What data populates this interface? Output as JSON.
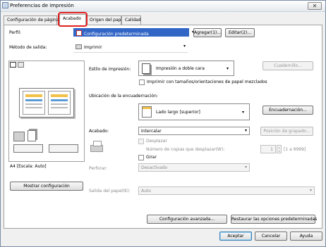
{
  "window": {
    "title": "Preferencias de impresión",
    "close_label": "✕"
  },
  "tabs": [
    {
      "label": "Configuración de página"
    },
    {
      "label": "Acabado"
    },
    {
      "label": "Origen del papel"
    },
    {
      "label": "Calidad"
    }
  ],
  "profile": {
    "label": "Perfil:",
    "value": "Configuración predeterminada",
    "add_button": "Agregar(1)...",
    "edit_button": "Editar(2)..."
  },
  "output_method": {
    "label": "Método de salida:",
    "value": "Imprimir"
  },
  "print_style": {
    "label": "Estilo de impresión:",
    "value": "Impresión a doble cara",
    "booklet_button": "Cuadernillo...",
    "mixed_sizes_label": "Imprimir con tamaños/orientaciones de papel mezclados"
  },
  "binding": {
    "label": "Ubicación de la encuadernación:",
    "value": "Lado largo [superior]",
    "button": "Encuadernación..."
  },
  "finishing": {
    "label": "Acabado:",
    "value": "Intercalar",
    "staple_button": "Posición de grapado...",
    "offset_label": "Desplazar",
    "offset_copies_label": "Número de copias que desplazar(W):",
    "offset_copies_value": "1",
    "offset_copies_range": "[1 a 9999]",
    "rotate_label": "Girar"
  },
  "punch": {
    "label": "Perforar:",
    "value": "Desactivado"
  },
  "paper_output": {
    "label": "Salida del papel(K):",
    "value": "Auto"
  },
  "preview": {
    "scale_text": "A4 [Escala: Auto]",
    "show_settings_button": "Mostrar configuración"
  },
  "bottom": {
    "advanced_button": "Configuración avanzada...",
    "restore_button": "Restaurar las opciones predeterminadas",
    "ok_button": "Aceptar",
    "cancel_button": "Cancelar",
    "help_button": "Ayuda"
  },
  "colors": {
    "highlight": "#e02020",
    "profile_bg": "#3165c6",
    "accent": "#3c7fb1"
  }
}
